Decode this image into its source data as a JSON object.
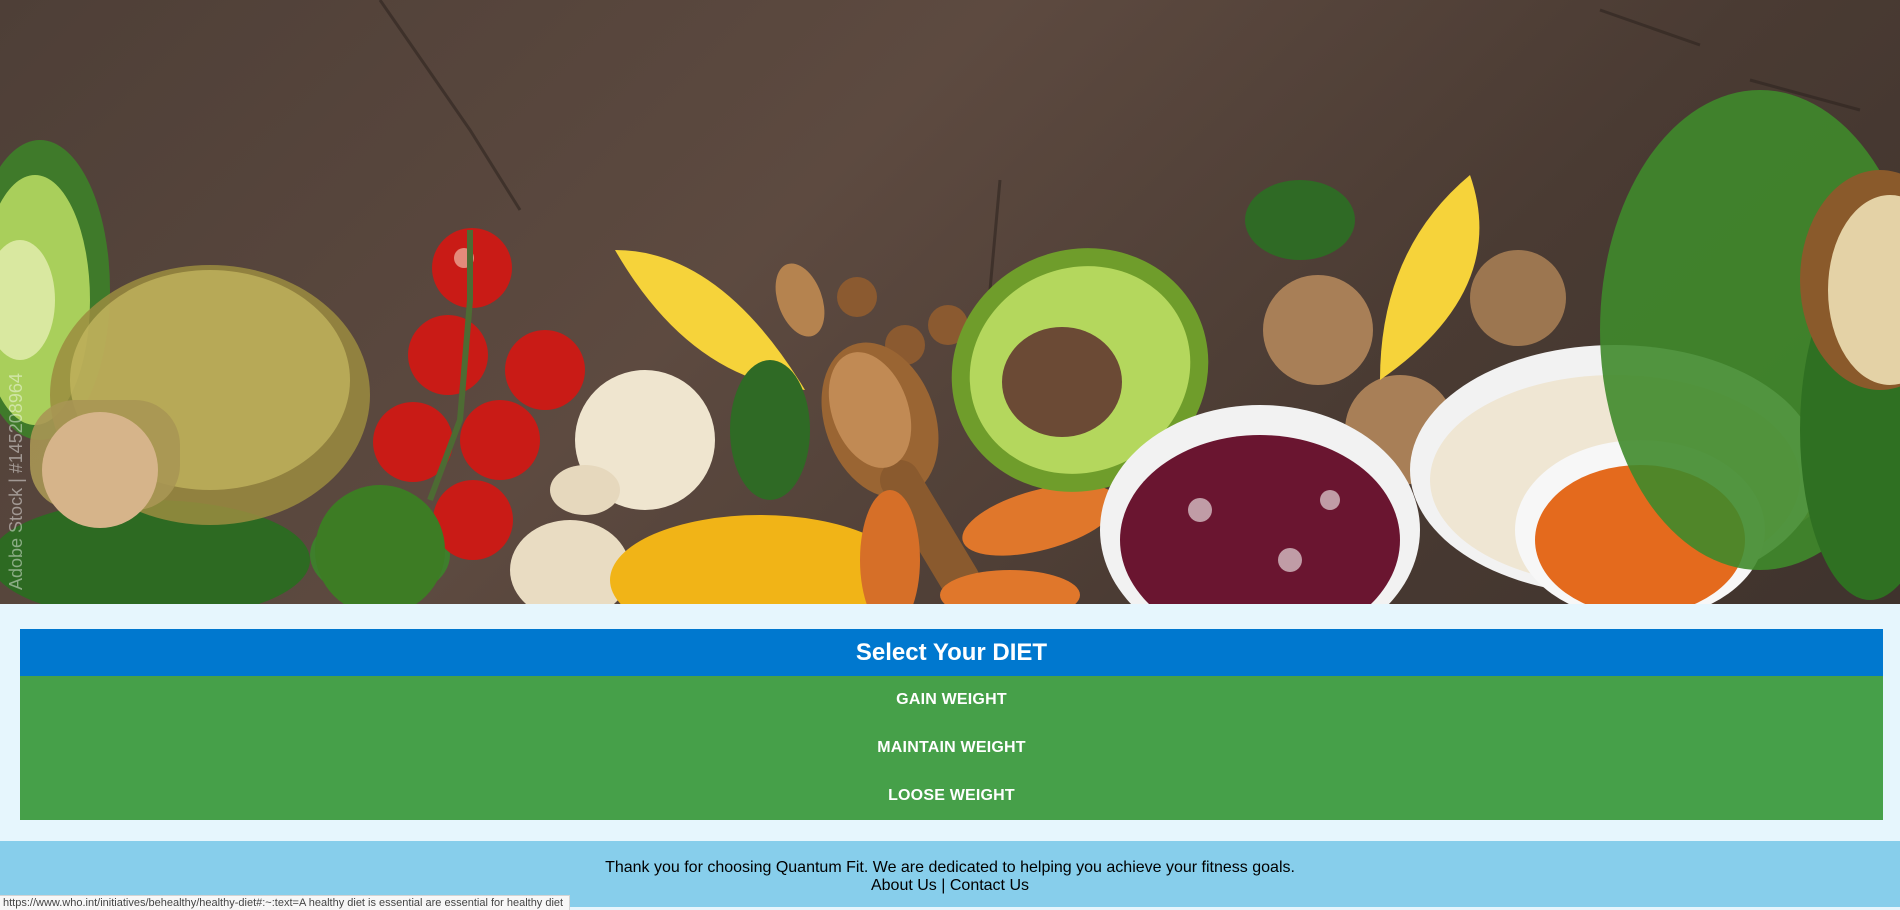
{
  "hero": {
    "watermark": "Adobe Stock | #145208964"
  },
  "diet": {
    "title": "Select Your DIET",
    "options": [
      {
        "label": "GAIN WEIGHT"
      },
      {
        "label": "MAINTAIN WEIGHT"
      },
      {
        "label": "LOOSE WEIGHT"
      }
    ]
  },
  "footer": {
    "text": "Thank you for choosing Quantum Fit. We are dedicated to helping you achieve your fitness goals.",
    "about_link": "About Us",
    "separator": "|",
    "contact_link": "Contact Us"
  },
  "status_bar": {
    "url": "https://www.who.int/initiatives/behealthy/healthy-diet#:~:text=A healthy diet is essential are essential for healthy diet"
  },
  "colors": {
    "header_bg": "#0078cf",
    "options_bg": "#46a049",
    "footer_bg": "#87ceeb",
    "page_bg": "#e6f6fd"
  }
}
